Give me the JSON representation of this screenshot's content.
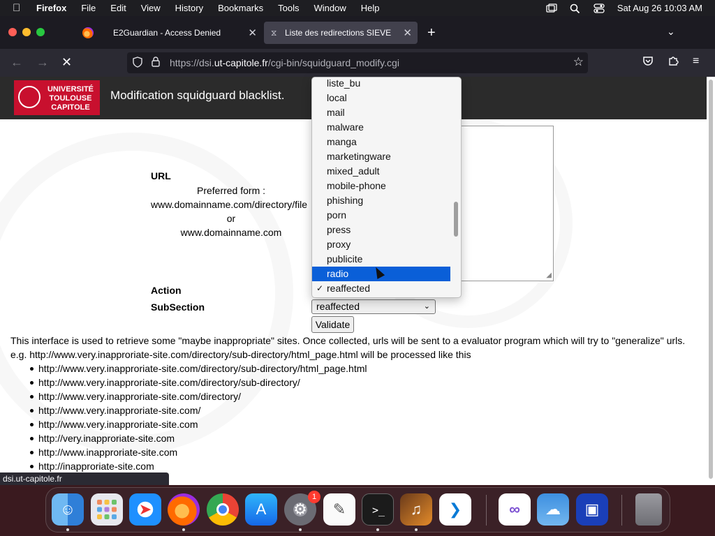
{
  "menubar": {
    "app": "Firefox",
    "items": [
      "File",
      "Edit",
      "View",
      "History",
      "Bookmarks",
      "Tools",
      "Window",
      "Help"
    ],
    "clock": "Sat Aug 26  10:03 AM"
  },
  "tabs": [
    {
      "label": "E2Guardian - Access Denied"
    },
    {
      "label": "Liste des redirections SIEVE"
    }
  ],
  "urlbar": {
    "prefix": "https://dsi.",
    "domain": "ut-capitole.fr",
    "path": "/cgi-bin/squidguard_modify.cgi"
  },
  "header": {
    "logo_text": "UNIVERSITÉ TOULOUSE CAPITOLE",
    "title": "Modification squidguard blacklist."
  },
  "form": {
    "url_label": "URL",
    "preferred_form": "Preferred form :",
    "example1": "www.domainname.com/directory/file",
    "or": "or",
    "example2": "www.domainname.com",
    "action_label": "Action",
    "subsection_label": "SubSection",
    "subsection_value": "reaffected",
    "validate": "Validate"
  },
  "dropdown": {
    "options": [
      "liste_bu",
      "local",
      "mail",
      "malware",
      "manga",
      "marketingware",
      "mixed_adult",
      "mobile-phone",
      "phishing",
      "porn",
      "press",
      "proxy",
      "publicite",
      "radio",
      "reaffected"
    ],
    "highlighted": "radio",
    "checked": "reaffected"
  },
  "description": {
    "line1": "This interface is used to retrieve some \"maybe inappropriate\" sites. Once collected, urls will be sent to a evaluator program which will try to \"generalize\" urls.",
    "line2": "e.g. http://www.very.inapproriate-site.com/directory/sub-directory/html_page.html will be processed like this",
    "urls": [
      "http://www.very.inapproriate-site.com/directory/sub-directory/html_page.html",
      "http://www.very.inapproriate-site.com/directory/sub-directory/",
      "http://www.very.inapproriate-site.com/directory/",
      "http://www.very.inapproriate-site.com/",
      "http://www.very.inapproriate-site.com",
      "http://very.inapproriate-site.com",
      "http://www.inapproriate-site.com",
      "http://inapproriate-site.com"
    ]
  },
  "status_text": "dsi.ut-capitole.fr",
  "dock": {
    "badge": "1",
    "icons": [
      "finder-icon",
      "launchpad-icon",
      "safari-icon",
      "firefox-icon",
      "chrome-icon",
      "app-store-icon",
      "system-settings-icon",
      "textedit-icon",
      "terminal-icon",
      "garageband-icon",
      "vscode-icon",
      "visual-studio-icon",
      "weather-icon",
      "remote-desktop-icon",
      "trash-icon"
    ]
  }
}
